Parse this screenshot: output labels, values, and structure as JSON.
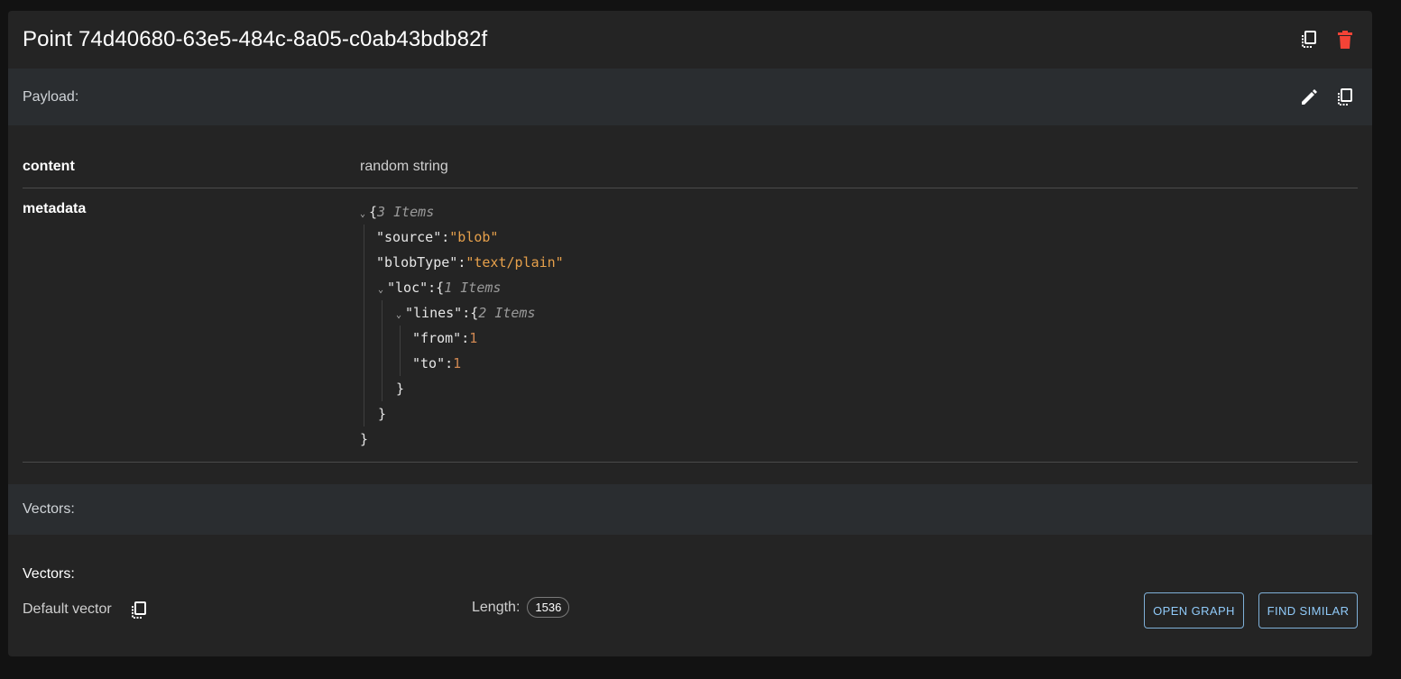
{
  "point": {
    "title": "Point 74d40680-63e5-484c-8a05-c0ab43bdb82f",
    "copy_icon": "copy-icon",
    "delete_icon": "trash-icon",
    "delete_color": "#f44336"
  },
  "payload": {
    "label": "Payload:",
    "edit_icon": "pencil-icon",
    "copy_icon": "copy-icon",
    "content_key": "content",
    "content_value": "random string",
    "metadata_key": "metadata",
    "metadata_tree": {
      "root_items": "3 Items",
      "source_key": "\"source\"",
      "source_value": "\"blob\"",
      "blobtype_key": "\"blobType\"",
      "blobtype_value": "\"text/plain\"",
      "loc_key": "\"loc\"",
      "loc_items": "1 Items",
      "lines_key": "\"lines\"",
      "lines_items": "2 Items",
      "from_key": "\"from\"",
      "from_value": "1",
      "to_key": "\"to\"",
      "to_value": "1"
    }
  },
  "vectors": {
    "section_label": "Vectors:",
    "title": "Vectors:",
    "default_vector_label": "Default vector",
    "length_label": "Length:",
    "length_value": "1536",
    "open_graph_label": "OPEN GRAPH",
    "find_similar_label": "FIND SIMILAR"
  }
}
